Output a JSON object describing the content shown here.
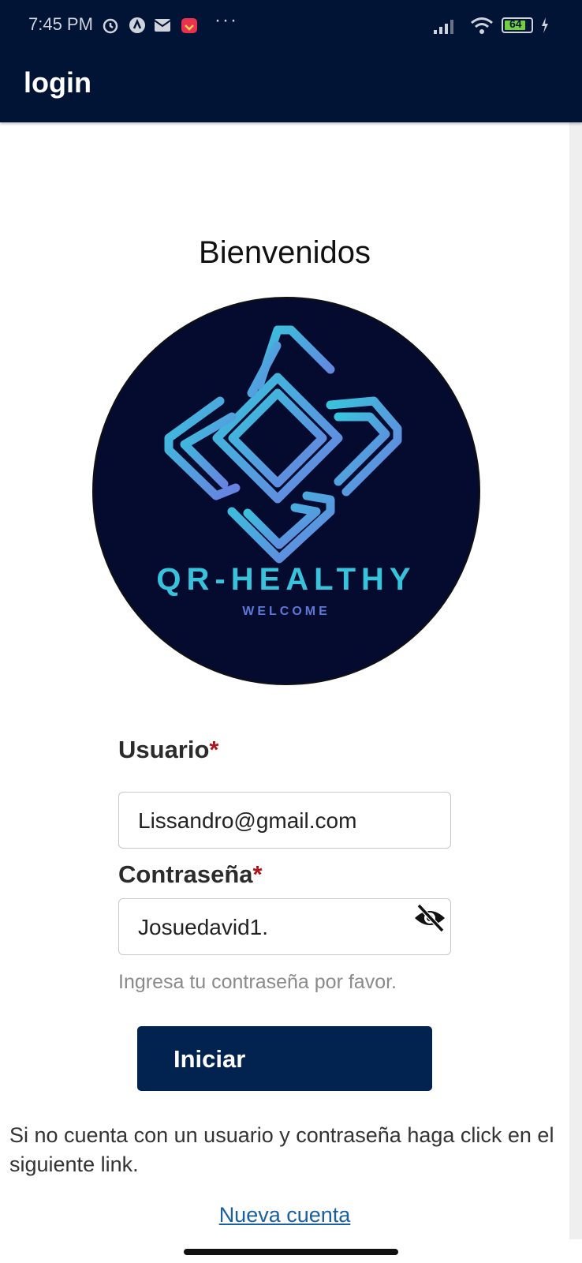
{
  "status_bar": {
    "time": "7:45 PM",
    "battery": "64",
    "more": "···"
  },
  "app_bar": {
    "title": "login"
  },
  "welcome": {
    "title": "Bienvenidos"
  },
  "logo": {
    "name": "QR-HEALTHY",
    "tagline": "WELCOME"
  },
  "form": {
    "username": {
      "label": "Usuario",
      "required_mark": "*",
      "value": "Lissandro@gmail.com"
    },
    "password": {
      "label": "Contraseña",
      "required_mark": "*",
      "value": "Josuedavid1.",
      "hint": "Ingresa tu contraseña por favor."
    },
    "submit_label": "Iniciar"
  },
  "signup": {
    "info_text": "Si no cuenta con un usuario y contraseña haga click en el siguiente link.",
    "link_label": "Nueva cuenta"
  },
  "colors": {
    "app_bar": "#021436",
    "button": "#022350",
    "link": "#1a5fa0",
    "required": "#b3141b",
    "logo_bg": "#050b2e",
    "logo_accent": "#38c3dc"
  },
  "icons": [
    "alarm-icon",
    "app-icon",
    "mail-icon",
    "shop-icon",
    "signal-icon",
    "wifi-icon",
    "battery-icon",
    "eye-off-icon"
  ]
}
